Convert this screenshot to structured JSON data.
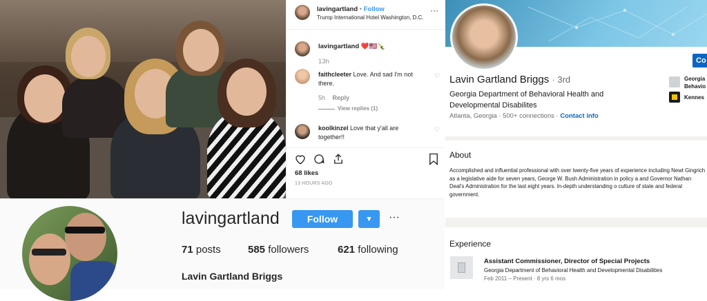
{
  "instagram_post": {
    "header": {
      "username": "lavingartland",
      "separator": "•",
      "follow_label": "Follow",
      "location": "Trump International Hotel Washington, D.C.",
      "more": "···"
    },
    "caption": {
      "username": "lavingartland",
      "text": "❤️🇺🇸🍾",
      "time": "13h"
    },
    "comments": [
      {
        "username": "faithcleeter",
        "text": "Love. And sad I'm not there.",
        "time": "5h",
        "reply": "Reply",
        "view_replies": "View replies (1)"
      },
      {
        "username": "koolkinzel",
        "text": "Love that y'all are together!!"
      }
    ],
    "likes": "68 likes",
    "timestamp": "13 HOURS AGO"
  },
  "instagram_profile": {
    "username": "lavingartland",
    "follow_label": "Follow",
    "dropdown_icon": "▾",
    "more": "···",
    "stats": {
      "posts_count": "71",
      "posts_label": "posts",
      "followers_count": "585",
      "followers_label": "followers",
      "following_count": "621",
      "following_label": "following"
    },
    "full_name": "Lavin Gartland Briggs"
  },
  "linkedin": {
    "name": "Lavin Gartland Briggs",
    "degree": "· 3rd",
    "headline": "Georgia Department of Behavioral Health and Developmental Disabilites",
    "location": "Atlanta, Georgia",
    "connections": "500+ connections",
    "contact": "Contact info",
    "connect_button": "Co",
    "side_items": [
      {
        "label_1": "Georgia",
        "label_2": "Behavio"
      },
      {
        "label_1": "Kennes",
        "label_2": ""
      }
    ],
    "about_title": "About",
    "about_text": "Accomplished and influential professional with over twenty-five years of experience including Newt Gingrich as a legislative aide for seven years, George W. Bush Administration in policy a and Governor Nathan Deal's Administration for the last eight years. In-depth understanding o culture of state and federal government.",
    "experience_title": "Experience",
    "experience": {
      "title": "Assistant Commissioner, Director of Special Projects",
      "org": "Georgia Department of Behavioral Health and Developmental Disabilities",
      "dates": "Feb 2011 – Present · 8 yrs 6 mos"
    }
  },
  "colors": {
    "ig_blue": "#3897f0",
    "li_blue": "#0a66c2"
  }
}
